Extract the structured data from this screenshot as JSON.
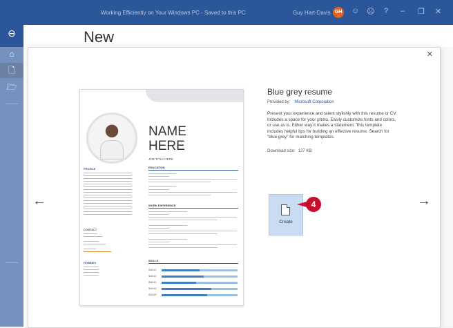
{
  "window": {
    "title": "Working Efficiently on Your Windows PC - Saved to this PC",
    "user": "Guy Hart-Davis",
    "avatar_initials": "GH"
  },
  "page": {
    "heading": "New"
  },
  "template": {
    "name": "Blue grey resume",
    "provided_by_label": "Provided by:",
    "provider": "Microsoft Corporation",
    "description": "Present your experience and talent stylishly with this resume or CV. Includes a space for your photo. Easily customize fonts and colors, or use as is. Either way it makes a statement. This template includes helpful tips for building an effective resume. Search for \"blue grey\" for matching templates.",
    "download_label": "Download size:",
    "download_size": "127 KB",
    "create_label": "Create"
  },
  "preview": {
    "name_line1": "NAME",
    "name_line2": "HERE",
    "job_title": "JOB TITLE HERE",
    "left_sections": [
      "PROFILE",
      "CONTACT",
      "HOBBIES"
    ],
    "right_sections": [
      "EDUCATION",
      "WORK EXPERIENCE",
      "SKILLS"
    ],
    "skills": [
      {
        "label": "Skill #1",
        "level": 0.5
      },
      {
        "label": "Skill #2",
        "level": 0.55
      },
      {
        "label": "Skill #3",
        "level": 0.45
      },
      {
        "label": "Skill #4",
        "level": 0.65
      },
      {
        "label": "Skill #5",
        "level": 0.6
      }
    ]
  },
  "callout": {
    "number": "4",
    "color": "#c8102e"
  },
  "colors": {
    "accent": "#2b579a",
    "create_button": "#c9dcf2"
  }
}
